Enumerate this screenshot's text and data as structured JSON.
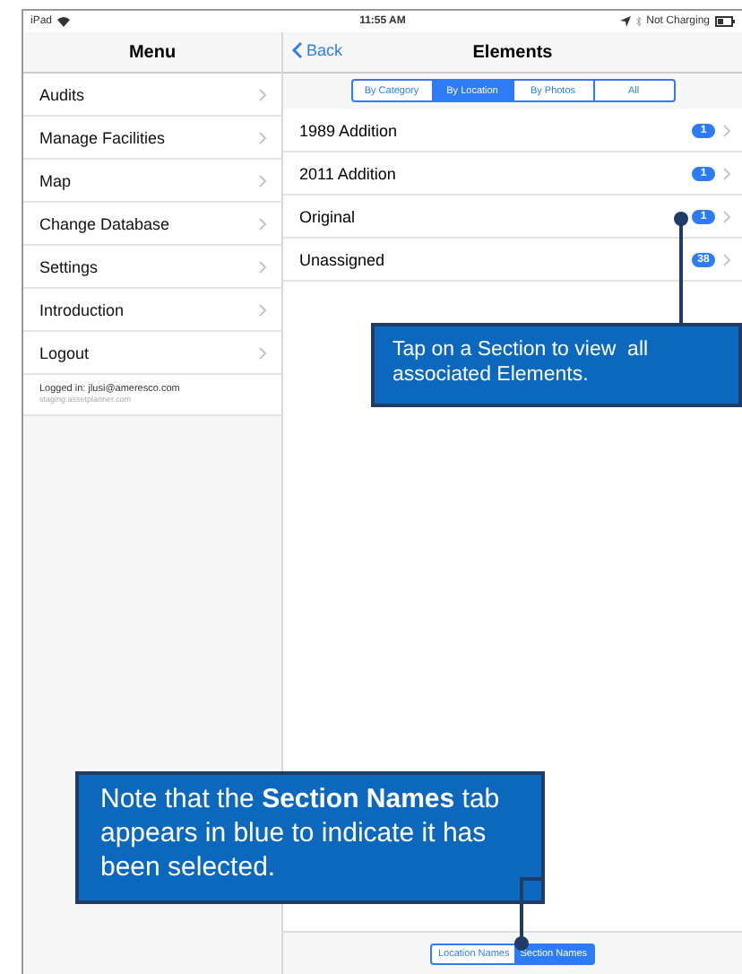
{
  "status_bar": {
    "device": "iPad",
    "time": "11:55 AM",
    "battery": "Not Charging"
  },
  "menu": {
    "title": "Menu",
    "items": [
      {
        "label": "Audits"
      },
      {
        "label": "Manage Facilities"
      },
      {
        "label": "Map"
      },
      {
        "label": "Change Database"
      },
      {
        "label": "Settings"
      },
      {
        "label": "Introduction"
      },
      {
        "label": "Logout"
      }
    ],
    "logged_in": "Logged in: jlusi@ameresco.com",
    "server": "staging.assetplanner.com"
  },
  "elements": {
    "back": "Back",
    "title": "Elements",
    "segments": [
      {
        "label": "By Category",
        "selected": false
      },
      {
        "label": "By Location",
        "selected": true
      },
      {
        "label": "By Photos",
        "selected": false
      },
      {
        "label": "All",
        "selected": false
      }
    ],
    "rows": [
      {
        "name": "1989 Addition",
        "count": "1"
      },
      {
        "name": "2011 Addition",
        "count": "1"
      },
      {
        "name": "Original",
        "count": "1"
      },
      {
        "name": "Unassigned",
        "count": "38"
      }
    ],
    "bottom_tabs": [
      {
        "label": "Location Names",
        "selected": false
      },
      {
        "label": "Section Names",
        "selected": true
      }
    ]
  },
  "callouts": [
    {
      "text": "Tap on a Section to view  all associated Elements."
    },
    {
      "text": "Note that the **Section Names** tab appears in blue to indicate it has been selected."
    }
  ]
}
